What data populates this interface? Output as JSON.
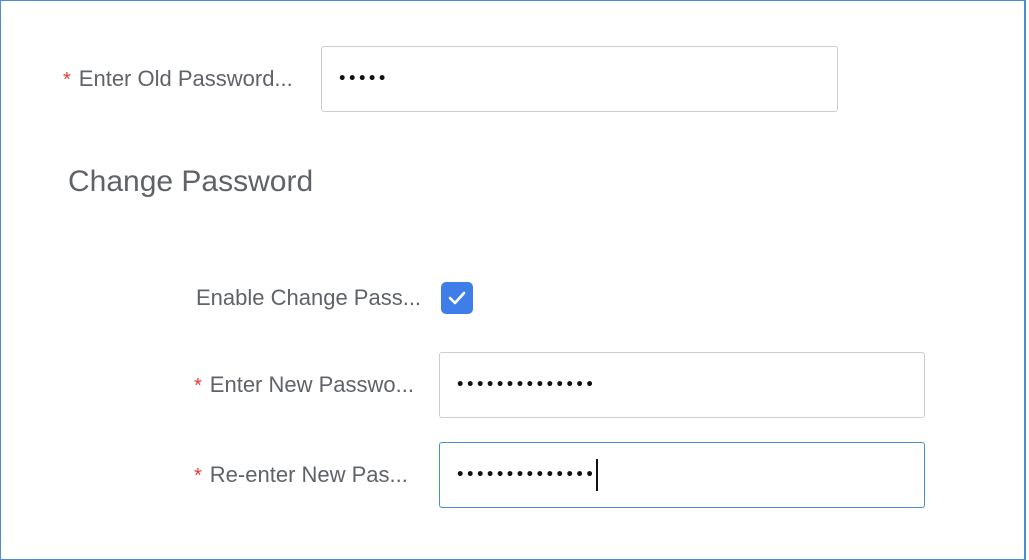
{
  "old_password": {
    "label": "Enter Old Password...",
    "required_mark": "*",
    "value_masked": "•••••"
  },
  "section": {
    "title": "Change Password"
  },
  "enable_change": {
    "label": "Enable Change Pass...",
    "checked": true
  },
  "new_password": {
    "label": "Enter New Passwo...",
    "required_mark": "*",
    "value_masked": "••••••••••••••"
  },
  "reenter_password": {
    "label": "Re-enter New Pas...",
    "required_mark": "*",
    "value_masked": "••••••••••••••"
  },
  "colors": {
    "accent": "#3f7ee8",
    "required": "#e53935",
    "label": "#5f6368",
    "frame_border": "#4a8fd0"
  }
}
